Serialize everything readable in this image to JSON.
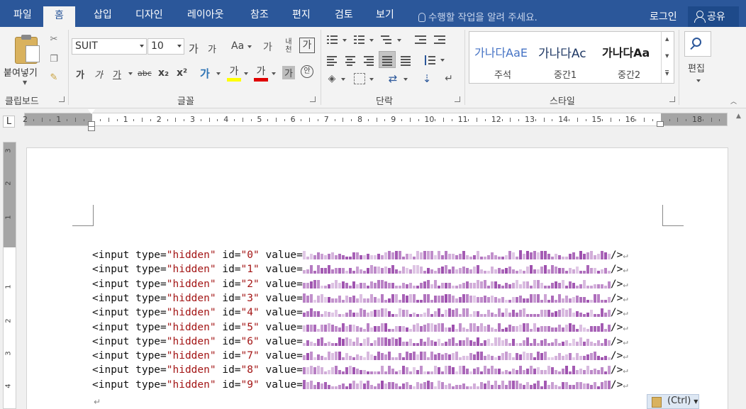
{
  "tabs": [
    {
      "label": "파일",
      "active": false
    },
    {
      "label": "홈",
      "active": true
    },
    {
      "label": "삽입",
      "active": false
    },
    {
      "label": "디자인",
      "active": false
    },
    {
      "label": "레이아웃",
      "active": false
    },
    {
      "label": "참조",
      "active": false
    },
    {
      "label": "편지",
      "active": false
    },
    {
      "label": "검토",
      "active": false
    },
    {
      "label": "보기",
      "active": false
    }
  ],
  "tell_me": "수행할 작업을 알려 주세요.",
  "account": {
    "login": "로그인",
    "share": "공유"
  },
  "groups": {
    "clipboard": "클립보드",
    "font": "글꼴",
    "paragraph": "단락",
    "styles": "스타일"
  },
  "clipboard": {
    "paste": "붙여넣기"
  },
  "font": {
    "name": "SUIT",
    "size": "10",
    "grow": "가",
    "shrink": "가",
    "case": "Aa",
    "clear": "가",
    "phonetic": "내천",
    "border_char": "가",
    "bold": "가",
    "italic": "가",
    "underline": "가",
    "strike": "abc",
    "subscript": "x₂",
    "superscript": "x²",
    "effects": "가",
    "highlight": "가",
    "font_color": "가",
    "shading": "가",
    "enclose": "안"
  },
  "styles": {
    "items": [
      {
        "sample": "가나다AaE",
        "caption": "주석",
        "color": "#4472c4"
      },
      {
        "sample": "가나다Ac",
        "caption": "중간1",
        "color": "#1f3864"
      },
      {
        "sample": "가나다Aa",
        "caption": "중간2",
        "color": "#1f1f1f"
      }
    ]
  },
  "editing": {
    "label": "편집"
  },
  "ruler": {
    "labels": [
      "2",
      "1",
      "",
      "1",
      "2",
      "3",
      "4",
      "5",
      "6",
      "7",
      "8",
      "9",
      "10",
      "11",
      "12",
      "13",
      "14",
      "15",
      "16",
      "",
      "18"
    ]
  },
  "vruler": {
    "labels": [
      "3",
      "2",
      "1",
      "1",
      "2",
      "3",
      "4"
    ]
  },
  "document": {
    "lines": [
      {
        "prefix": "<input type=",
        "type": "\"hidden\"",
        "mid": " id=",
        "id": "\"0\"",
        "val": " value=",
        "end": "/>"
      },
      {
        "prefix": "<input type=",
        "type": "\"hidden\"",
        "mid": " id=",
        "id": "\"1\"",
        "val": " value=",
        "end": "/>"
      },
      {
        "prefix": "<input type=",
        "type": "\"hidden\"",
        "mid": " id=",
        "id": "\"2\"",
        "val": " value=",
        "end": "/>"
      },
      {
        "prefix": "<input type=",
        "type": "\"hidden\"",
        "mid": " id=",
        "id": "\"3\"",
        "val": " value=",
        "end": "/>"
      },
      {
        "prefix": "<input type=",
        "type": "\"hidden\"",
        "mid": " id=",
        "id": "\"4\"",
        "val": " value=",
        "end": "/>"
      },
      {
        "prefix": "<input type=",
        "type": "\"hidden\"",
        "mid": " id=",
        "id": "\"5\"",
        "val": " value=",
        "end": "/>"
      },
      {
        "prefix": "<input type=",
        "type": "\"hidden\"",
        "mid": " id=",
        "id": "\"6\"",
        "val": " value=",
        "end": "/>"
      },
      {
        "prefix": "<input type=",
        "type": "\"hidden\"",
        "mid": " id=",
        "id": "\"7\"",
        "val": " value=",
        "end": "/>"
      },
      {
        "prefix": "<input type=",
        "type": "\"hidden\"",
        "mid": " id=",
        "id": "\"8\"",
        "val": " value=",
        "end": "/>"
      },
      {
        "prefix": "<input type=",
        "type": "\"hidden\"",
        "mid": " id=",
        "id": "\"9\"",
        "val": " value=",
        "end": "/>"
      }
    ],
    "paste_options": "(Ctrl)"
  },
  "colors": {
    "accent": "#2b579a",
    "string": "#a31515",
    "noise": "#8a2d9e"
  }
}
